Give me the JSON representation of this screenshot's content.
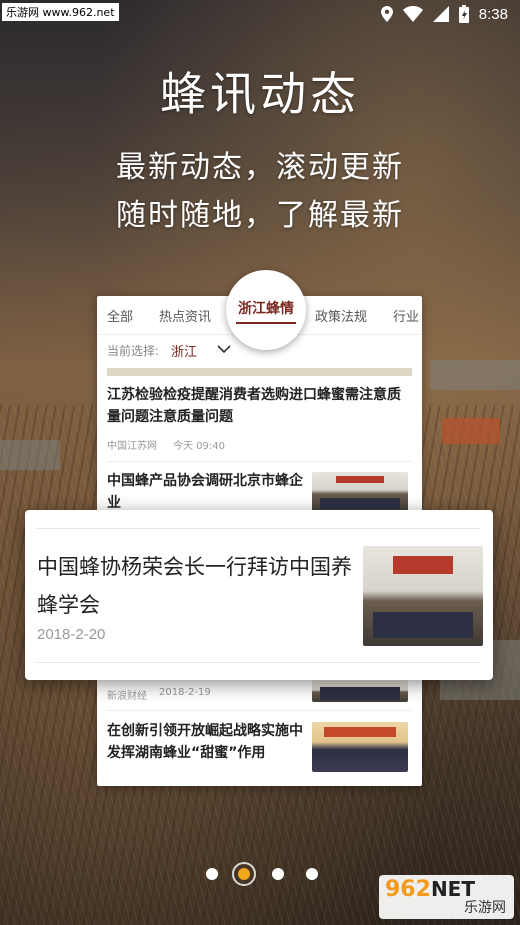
{
  "status_bar": {
    "site_badge": "乐游网 www.962.net",
    "time": "8:38",
    "icons": [
      "location-icon",
      "wifi-icon",
      "signal-icon",
      "battery-icon"
    ]
  },
  "hero": {
    "title": "蜂讯动态",
    "subtitle_line1": "最新动态，滚动更新",
    "subtitle_line2": "随时随地，了解最新"
  },
  "news_card": {
    "tabs": [
      "全部",
      "热点资讯",
      "浙江蜂情",
      "政策法规",
      "行业"
    ],
    "active_tab": "浙江蜂情",
    "selector": {
      "label": "当前选择:",
      "value": "浙江"
    },
    "articles": [
      {
        "title": "江苏检验检疫提醒消费者选购进口蜂蜜需注意质量问题注意质量问题",
        "source": "中国江苏网",
        "time": "今天 09:40"
      },
      {
        "title": "中国蜂产品协会调研北京市蜂企业"
      },
      {
        "title": "中国蜂协杨荣会长一行拜访中国养蜂学会",
        "date": "2018-2-20"
      },
      {
        "source": "新浪财经",
        "time": "2018-2-19"
      },
      {
        "title": "在创新引领开放崛起战略实施中发挥湖南蜂业“甜蜜”作用"
      }
    ]
  },
  "pager": {
    "count": 4,
    "active_index": 1
  },
  "watermark": {
    "top": "962",
    "net": "NET",
    "bottom": "乐游网"
  },
  "colors": {
    "accent": "#7a2a22",
    "pager_active": "#f2a81d"
  }
}
